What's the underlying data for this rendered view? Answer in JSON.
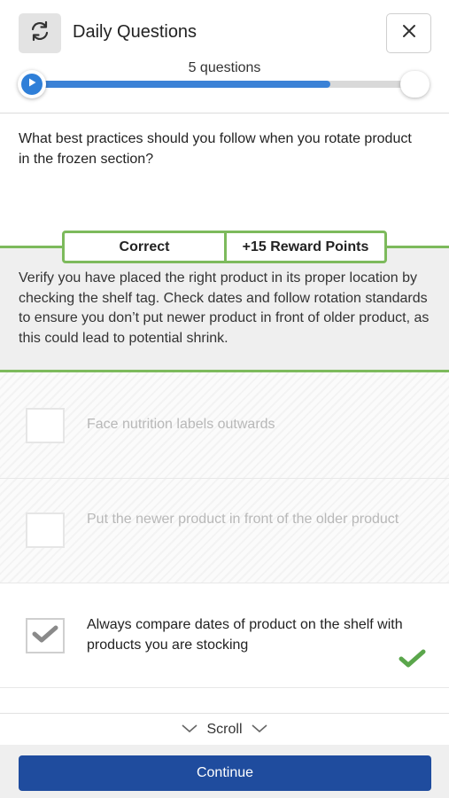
{
  "header": {
    "title": "Daily Questions",
    "refresh_icon": "refresh-icon",
    "close_icon": "close-icon"
  },
  "progress": {
    "label": "5 questions",
    "fraction": 0.78,
    "color": "#3b82d6"
  },
  "question": {
    "text": "What best practices should you follow when you rotate product in the frozen section?"
  },
  "feedback": {
    "status": "Correct",
    "reward": "+15 Reward Points",
    "explanation": "Verify you have placed the right product in its proper location by checking the shelf tag. Check dates and follow rotation standards to ensure you don’t put newer product in front of older product, as this could lead to potential shrink.",
    "accent_color": "#7dba5c"
  },
  "answers": [
    {
      "text": "Face nutrition labels outwards",
      "selected": false
    },
    {
      "text": "Put the newer product in front of the older product",
      "selected": false
    },
    {
      "text": "Always compare dates of product on the shelf with products you are stocking",
      "selected": true,
      "correct": true
    }
  ],
  "scroll": {
    "label": "Scroll"
  },
  "footer": {
    "continue_label": "Continue",
    "button_color": "#1f4c9e"
  }
}
